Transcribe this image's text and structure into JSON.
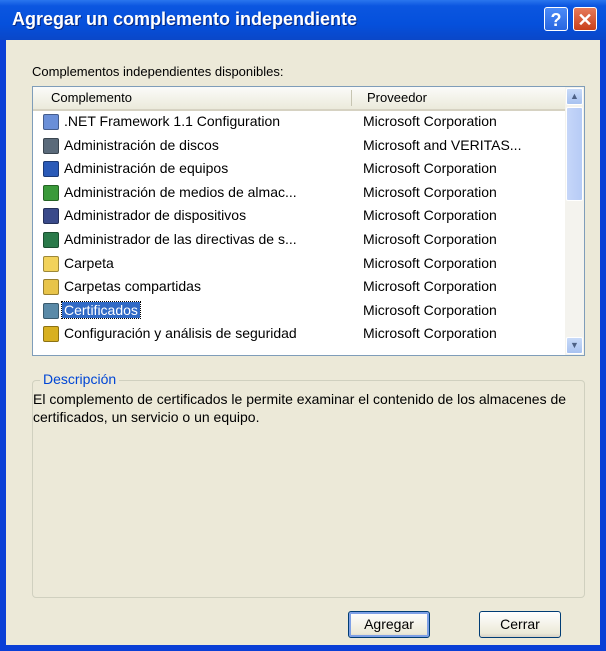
{
  "window": {
    "title": "Agregar un complemento independiente",
    "help_label": "?",
    "close_label": "✕"
  },
  "available_label": "Complementos independientes disponibles:",
  "columns": {
    "name": "Complemento",
    "provider": "Proveedor"
  },
  "rows": [
    {
      "name": ".NET Framework 1.1 Configuration",
      "provider": "Microsoft Corporation",
      "icon": "dotnet-config-icon",
      "color": "#6a8fd8"
    },
    {
      "name": "Administración de discos",
      "provider": "Microsoft and VERITAS...",
      "icon": "disk-management-icon",
      "color": "#5a6a7a"
    },
    {
      "name": "Administración de equipos",
      "provider": "Microsoft Corporation",
      "icon": "computer-management-icon",
      "color": "#2a5ab8"
    },
    {
      "name": "Administración de medios de almac...",
      "provider": "Microsoft Corporation",
      "icon": "removable-storage-icon",
      "color": "#3a9a3a"
    },
    {
      "name": "Administrador de dispositivos",
      "provider": "Microsoft Corporation",
      "icon": "device-manager-icon",
      "color": "#3a4a8a"
    },
    {
      "name": "Administrador de las directivas de s...",
      "provider": "Microsoft Corporation",
      "icon": "policy-manager-icon",
      "color": "#2a7a4a"
    },
    {
      "name": "Carpeta",
      "provider": "Microsoft Corporation",
      "icon": "folder-icon",
      "color": "#f2d25a"
    },
    {
      "name": "Carpetas compartidas",
      "provider": "Microsoft Corporation",
      "icon": "shared-folders-icon",
      "color": "#e8c44a"
    },
    {
      "name": "Certificados",
      "provider": "Microsoft Corporation",
      "icon": "certificates-icon",
      "color": "#5a8aa8",
      "selected": true
    },
    {
      "name": "Configuración y análisis de seguridad",
      "provider": "Microsoft Corporation",
      "icon": "security-analysis-icon",
      "color": "#d8b020"
    }
  ],
  "description": {
    "legend": "Descripción",
    "text": "El complemento de certificados le permite  examinar el contenido de los almacenes de certificados, un servicio o un equipo."
  },
  "buttons": {
    "add": "Agregar",
    "close": "Cerrar"
  }
}
